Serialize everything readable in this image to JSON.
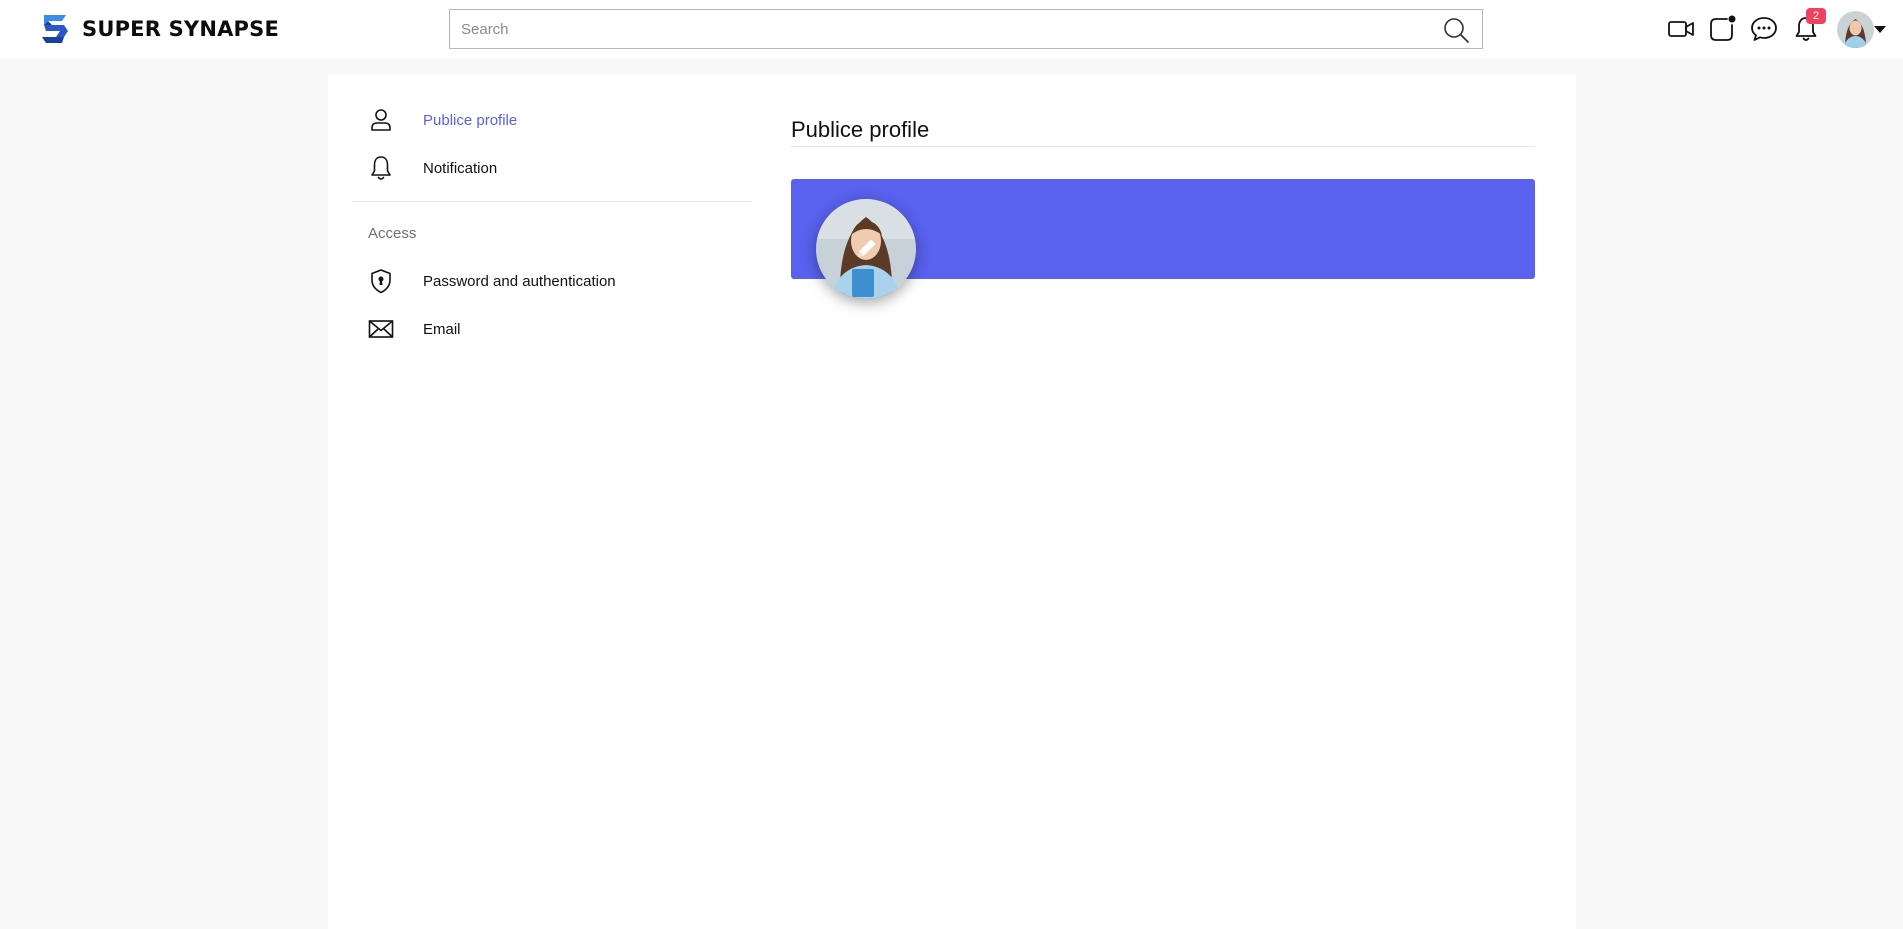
{
  "app": {
    "brand_name": "SUPER SYNAPSE",
    "brand_color": "#2b57c9"
  },
  "header": {
    "search_placeholder": "Search",
    "search_value": "",
    "icons": [
      "video-icon",
      "stories-icon",
      "chat-icon",
      "bell-icon"
    ],
    "notification_count": "2",
    "badge_color": "#f0425e"
  },
  "sidebar": {
    "items": [
      {
        "label": "Publice profile",
        "icon": "person-icon",
        "active": true
      },
      {
        "label": "Notification",
        "icon": "bell-icon",
        "active": false
      }
    ],
    "section_label": "Access",
    "access_items": [
      {
        "label": "Password and authentication",
        "icon": "shield-icon"
      },
      {
        "label": "Email",
        "icon": "envelope-icon"
      }
    ],
    "active_color": "#5a61e8"
  },
  "main": {
    "title": "Publice profile",
    "banner_color": "#5961ee"
  }
}
